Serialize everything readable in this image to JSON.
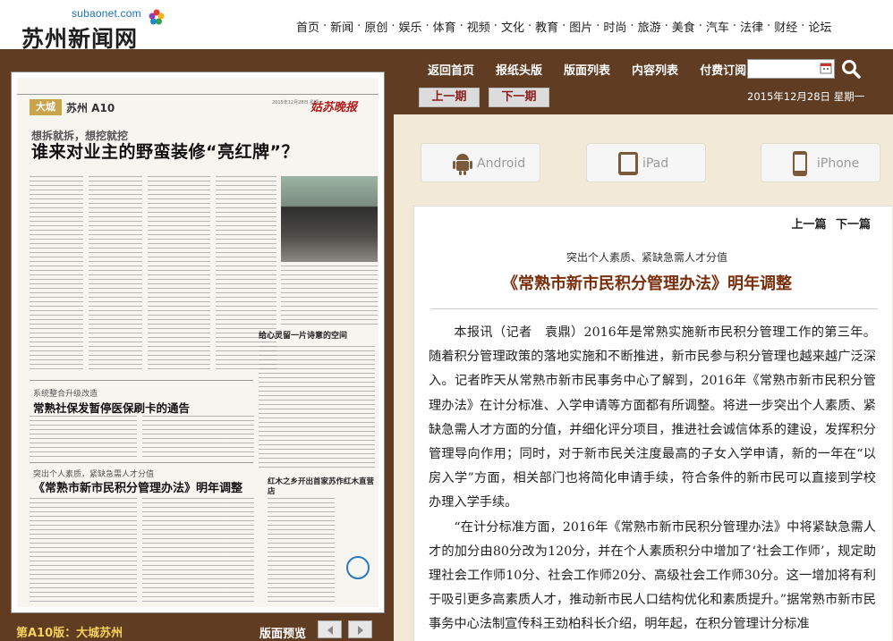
{
  "site": {
    "logo_domain": "subaonet.com",
    "logo_name": "苏州新闻网"
  },
  "top_nav": [
    "首页",
    "新闻",
    "原创",
    "娱乐",
    "体育",
    "视频",
    "文化",
    "教育",
    "图片",
    "时尚",
    "旅游",
    "美食",
    "汽车",
    "法律",
    "财经",
    "论坛"
  ],
  "sub_nav": [
    "返回首页",
    "报纸头版",
    "版面列表",
    "内容列表",
    "付费订阅"
  ],
  "search": {
    "value": ""
  },
  "period": {
    "prev": "上一期",
    "next": "下一期"
  },
  "date": "2015年12月28日  星期一",
  "newspaper": {
    "edition_tag": "大城",
    "edition_name": "苏州 A10",
    "paper_name": "姑苏晚报",
    "paper_date": "2015年12月28日 星期一",
    "kicker": "想拆就拆，想挖就挖",
    "headline": "谁来对业主的野蛮装修“亮红牌”？",
    "sub1_kicker": "系统整合升级改造",
    "sub1_title": "常熟社保发暂停医保刷卡的通告",
    "sub2_kicker": "突出个人素质，紧缺急需人才分值",
    "sub2_title": "《常熟市新市民积分管理办法》明年调整",
    "side_title": "给心灵留一片诗意的空间",
    "side_title2": "红木之乡开出首家苏作红木直营店"
  },
  "edition_label": "第A10版：大城苏州",
  "preview_label": "版面预览",
  "apps": [
    "Android",
    "iPad",
    "iPhone"
  ],
  "article": {
    "nav_prev": "上一篇",
    "nav_next": "下一篇",
    "subtitle": "突出个人素质、紧缺急需人才分值",
    "title": "《常熟市新市民积分管理办法》明年调整",
    "paragraphs": [
      "本报讯（记者　袁鼎）2016年是常熟实施新市民积分管理工作的第三年。随着积分管理政策的落地实施和不断推进，新市民参与积分管理也越来越广泛深入。记者昨天从常熟市新市民事务中心了解到，2016年《常熟市新市民积分管理办法》在计分标准、入学申请等方面都有所调整。将进一步突出个人素质、紧缺急需人才方面的分值，并细化评分项目，推进社会诚信体系的建设，发挥积分管理导向作用；同时，对于新市民关注度最高的子女入学申请，新的一年在“以房入学”方面，相关部门也将简化申请手续，符合条件的新市民可以直接到学校办理入学手续。",
      "“在计分标准方面，2016年《常熟市新市民积分管理办法》中将紧缺急需人才的加分由80分改为120分，并在个人素质积分中增加了‘社会工作师’，规定助理社会工作师10分、社会工作师20分、高级社会工作师30分。这一增加将有利于吸引更多高素质人才，推动新市民人口结构优化和素质提升。”据常熟市新市民事务中心法制宣传科王劲柏科长介绍，明年起，在积分管理计分标准"
    ]
  }
}
